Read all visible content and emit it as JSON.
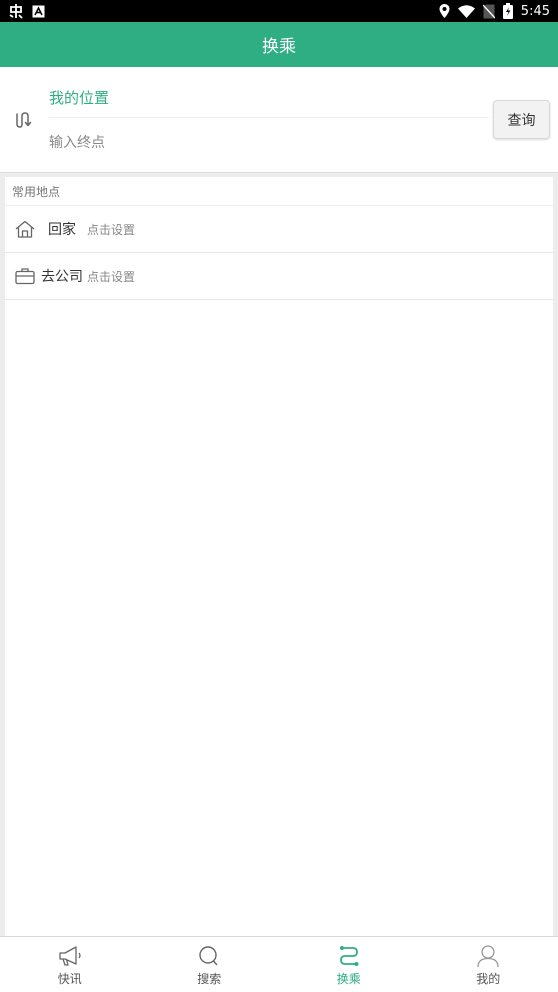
{
  "status_bar": {
    "time": "5:45",
    "left_icons": [
      "app-notification-icon",
      "a-square-icon"
    ],
    "right_icons": [
      "location-icon",
      "wifi-icon",
      "no-sim-icon",
      "battery-icon"
    ]
  },
  "header": {
    "title": "换乘"
  },
  "route": {
    "origin": "我的位置",
    "destination_placeholder": "输入终点",
    "destination_value": "",
    "query_label": "查询",
    "swap_icon": "swap-route-icon"
  },
  "common_places": {
    "title": "常用地点",
    "items": [
      {
        "icon": "home-icon",
        "label": "回家",
        "hint": "点击设置"
      },
      {
        "icon": "briefcase-icon",
        "label": "去公司",
        "hint": "点击设置"
      }
    ]
  },
  "nav": {
    "items": [
      {
        "icon": "megaphone-icon",
        "label": "快讯",
        "active": false
      },
      {
        "icon": "search-icon",
        "label": "搜索",
        "active": false
      },
      {
        "icon": "transfer-icon",
        "label": "换乘",
        "active": true
      },
      {
        "icon": "person-icon",
        "label": "我的",
        "active": false
      }
    ]
  },
  "colors": {
    "accent": "#2fae84",
    "status_bar": "#000000",
    "background": "#ececec",
    "text_primary": "#333333",
    "text_secondary": "#888888"
  }
}
